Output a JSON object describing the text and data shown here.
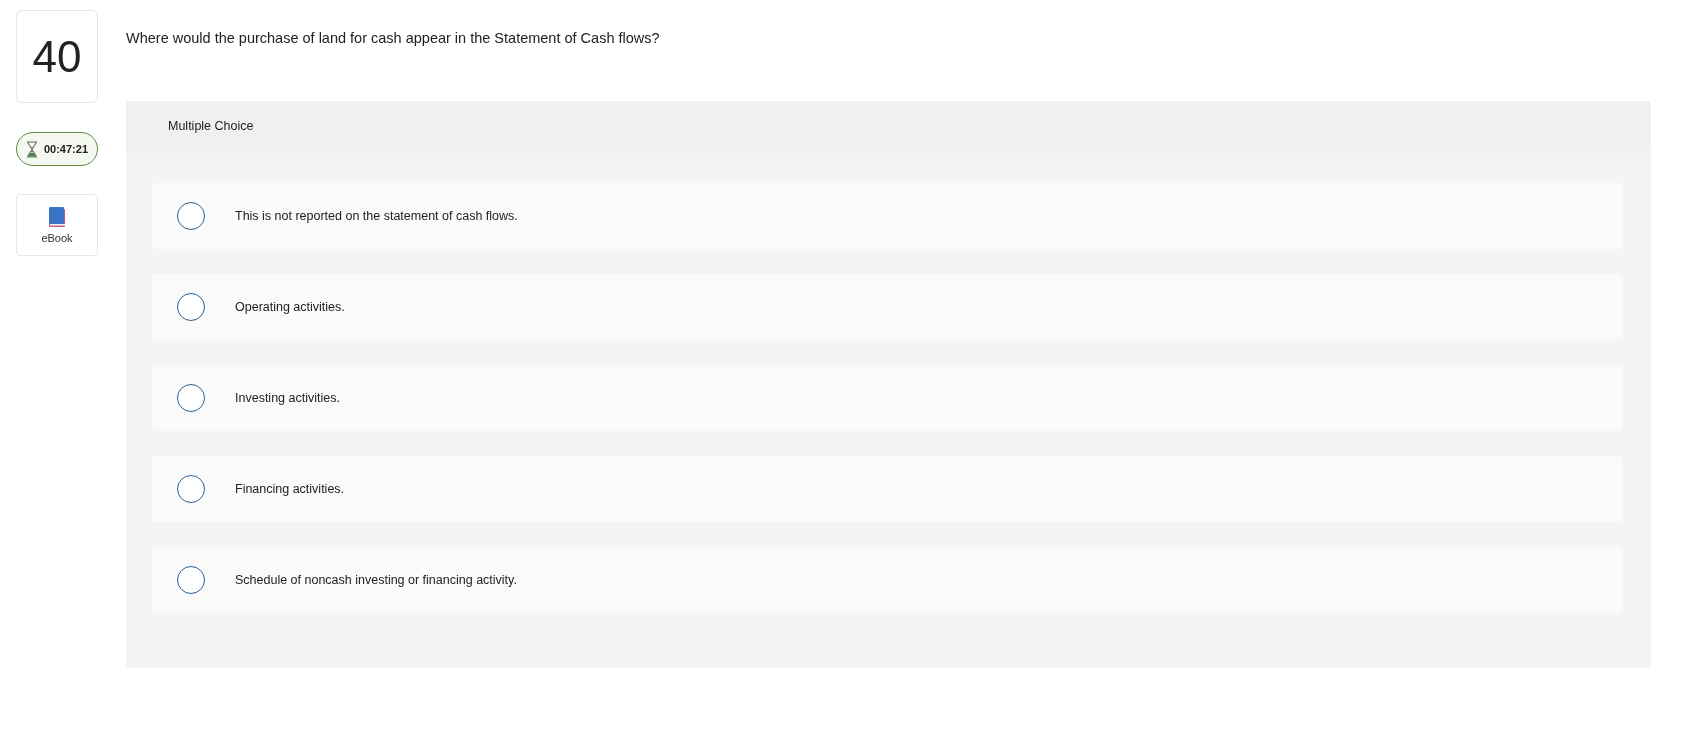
{
  "question": {
    "number": "40",
    "text": "Where would the purchase of land for cash appear in the Statement of Cash flows?"
  },
  "timer": {
    "time": "00:47:21"
  },
  "ebook": {
    "label": "eBook"
  },
  "answer": {
    "type_label": "Multiple Choice",
    "choices": [
      {
        "text": "This is not reported on the statement of cash flows.",
        "selected": false
      },
      {
        "text": "Operating activities.",
        "selected": false
      },
      {
        "text": "Investing activities.",
        "selected": false
      },
      {
        "text": "Financing activities.",
        "selected": false
      },
      {
        "text": "Schedule of noncash investing or financing activity.",
        "selected": false
      }
    ]
  }
}
